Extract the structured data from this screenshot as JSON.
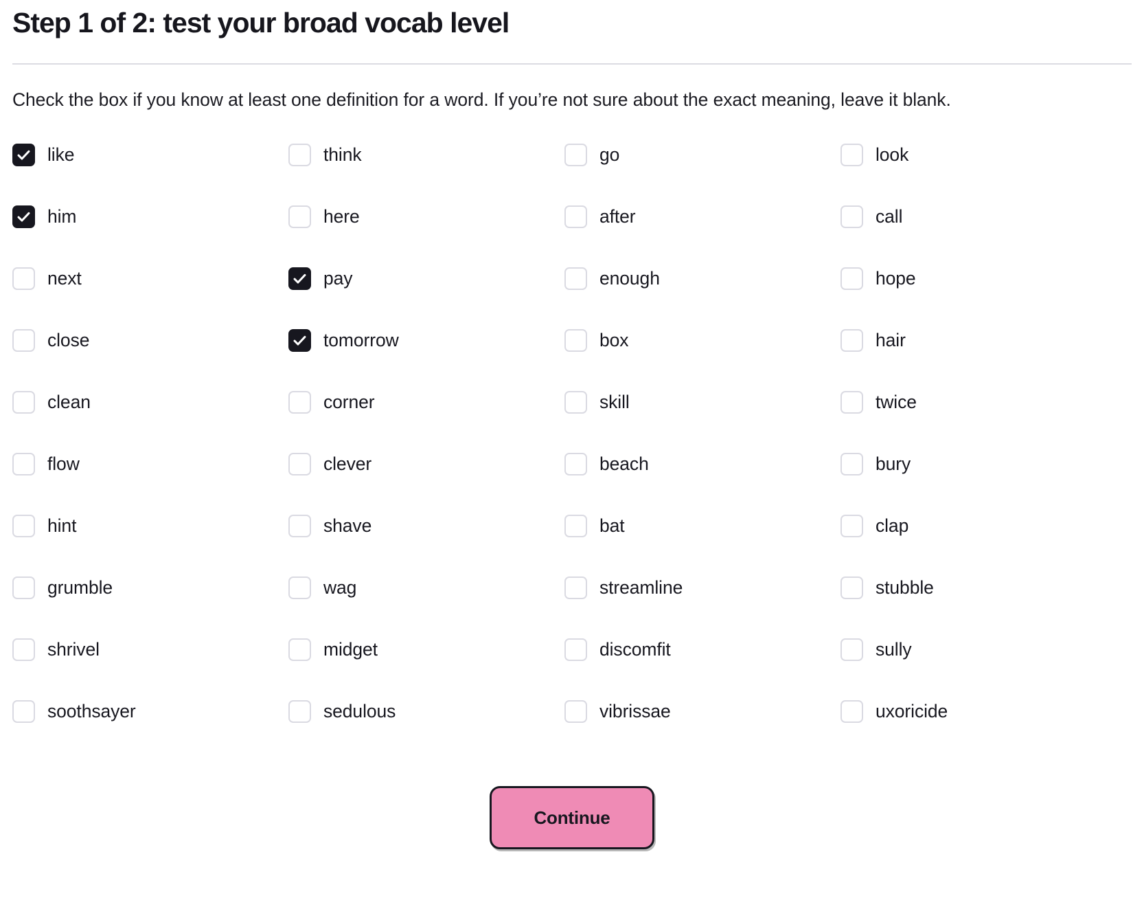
{
  "header": {
    "title": "Step 1 of 2: test your broad vocab level",
    "instructions": "Check the box if you know at least one definition for a word. If you’re not sure about the exact meaning, leave it blank."
  },
  "colors": {
    "accent_button": "#ef8bb5",
    "checkbox_checked": "#17171f",
    "checkbox_border": "#dadae2",
    "text": "#17171f",
    "divider": "#dcdce2"
  },
  "word_grid": {
    "columns": 4,
    "rows": 11,
    "checked_count": 4,
    "items": [
      {
        "label": "like",
        "checked": true
      },
      {
        "label": "think",
        "checked": false
      },
      {
        "label": "go",
        "checked": false
      },
      {
        "label": "look",
        "checked": false
      },
      {
        "label": "him",
        "checked": true
      },
      {
        "label": "here",
        "checked": false
      },
      {
        "label": "after",
        "checked": false
      },
      {
        "label": "call",
        "checked": false
      },
      {
        "label": "next",
        "checked": false
      },
      {
        "label": "pay",
        "checked": true
      },
      {
        "label": "enough",
        "checked": false
      },
      {
        "label": "hope",
        "checked": false
      },
      {
        "label": "close",
        "checked": false
      },
      {
        "label": "tomorrow",
        "checked": true
      },
      {
        "label": "box",
        "checked": false
      },
      {
        "label": "hair",
        "checked": false
      },
      {
        "label": "clean",
        "checked": false
      },
      {
        "label": "corner",
        "checked": false
      },
      {
        "label": "skill",
        "checked": false
      },
      {
        "label": "twice",
        "checked": false
      },
      {
        "label": "flow",
        "checked": false
      },
      {
        "label": "clever",
        "checked": false
      },
      {
        "label": "beach",
        "checked": false
      },
      {
        "label": "bury",
        "checked": false
      },
      {
        "label": "hint",
        "checked": false
      },
      {
        "label": "shave",
        "checked": false
      },
      {
        "label": "bat",
        "checked": false
      },
      {
        "label": "clap",
        "checked": false
      },
      {
        "label": "grumble",
        "checked": false
      },
      {
        "label": "wag",
        "checked": false
      },
      {
        "label": "streamline",
        "checked": false
      },
      {
        "label": "stubble",
        "checked": false
      },
      {
        "label": "shrivel",
        "checked": false
      },
      {
        "label": "midget",
        "checked": false
      },
      {
        "label": "discomfit",
        "checked": false
      },
      {
        "label": "sully",
        "checked": false
      },
      {
        "label": "soothsayer",
        "checked": false
      },
      {
        "label": "sedulous",
        "checked": false
      },
      {
        "label": "vibrissae",
        "checked": false
      },
      {
        "label": "uxoricide",
        "checked": false
      }
    ]
  },
  "footer": {
    "continue_label": "Continue"
  }
}
